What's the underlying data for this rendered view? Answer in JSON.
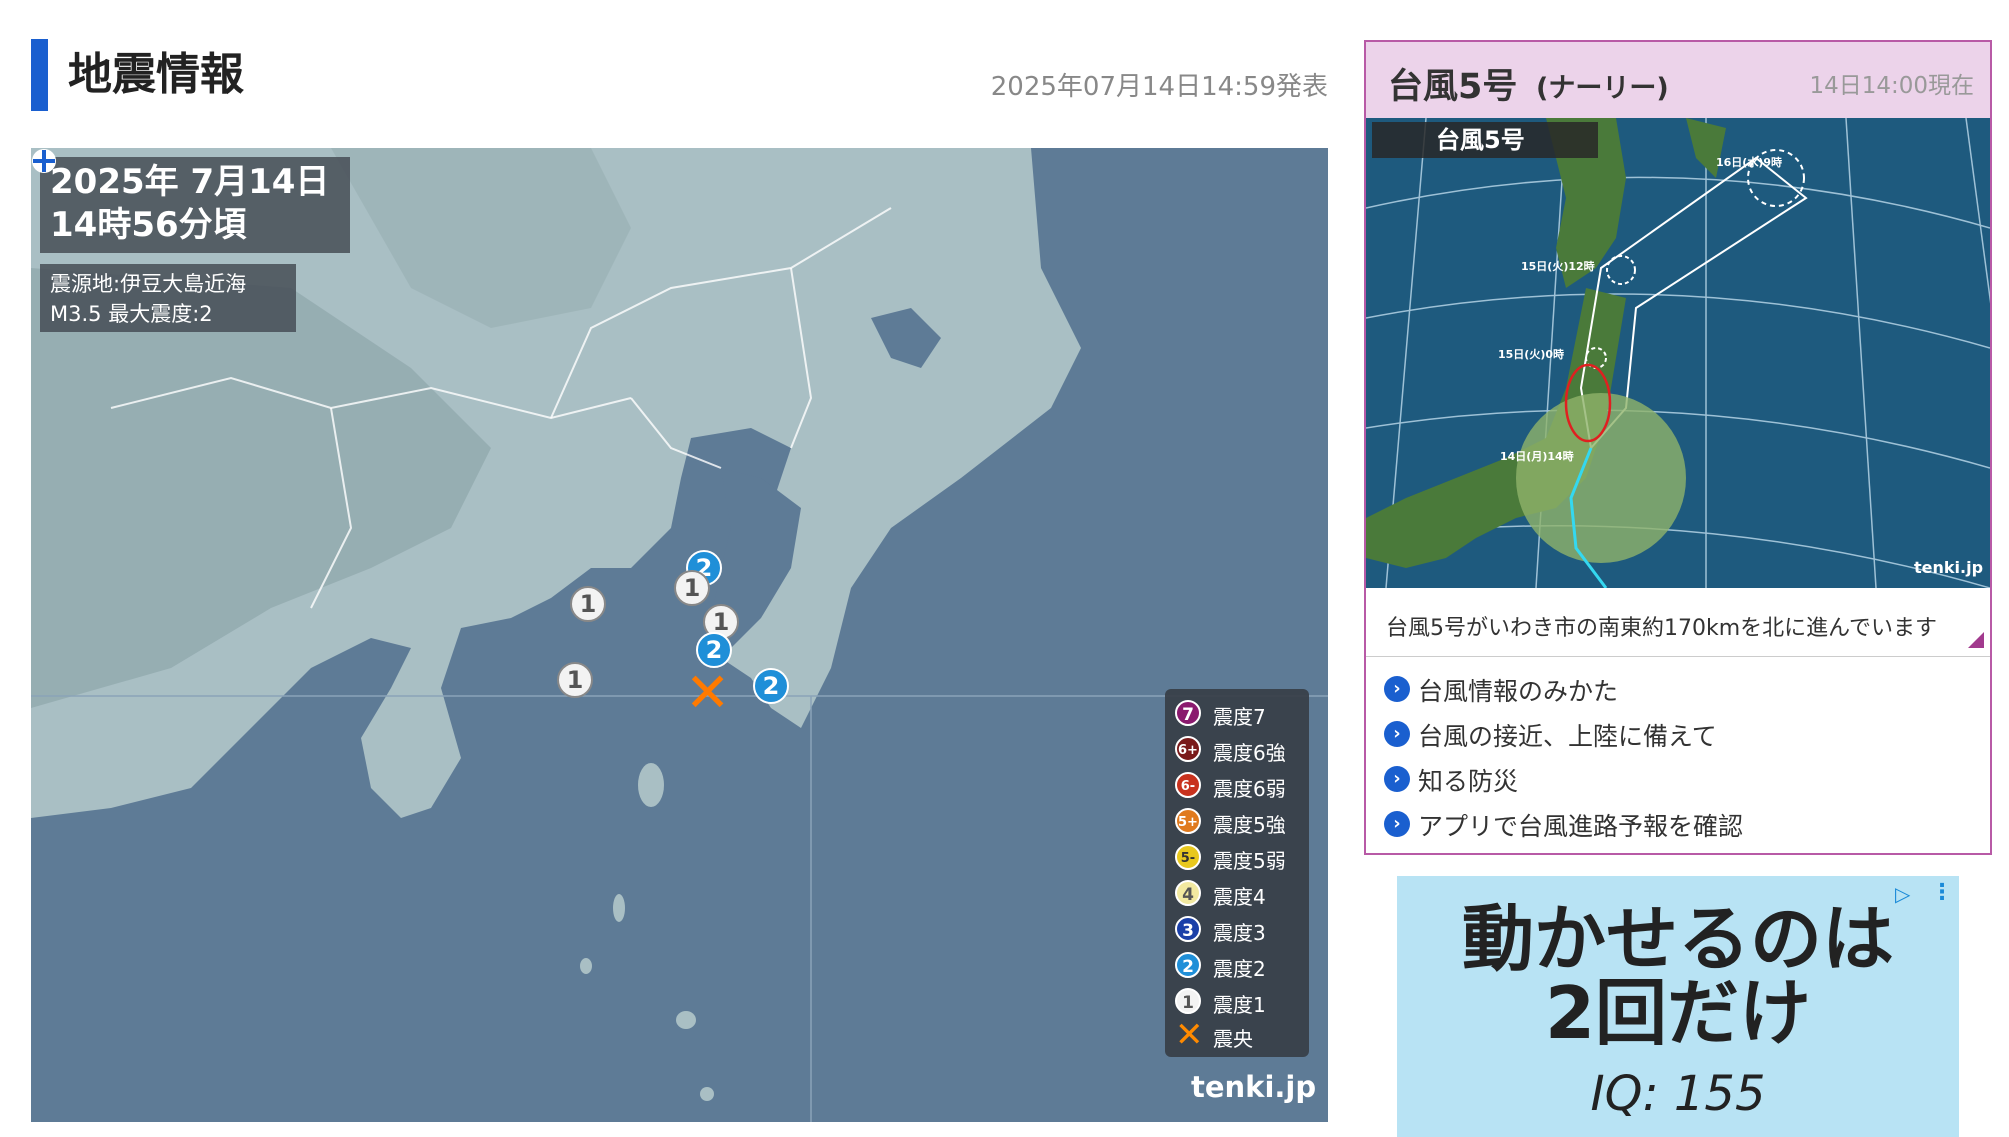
{
  "earthquake": {
    "title": "地震情報",
    "issued": "2025年07月14日14:59発表",
    "date": "2025年  7月14日",
    "time": "14時56分頃",
    "epicenter": "震源地:伊豆大島近海",
    "magnitude": "M3.5   最大震度:2",
    "markers": [
      {
        "value": "2",
        "level": 2
      },
      {
        "value": "1",
        "level": 1
      },
      {
        "value": "1",
        "level": 1
      },
      {
        "value": "1",
        "level": 1
      },
      {
        "value": "2",
        "level": 2
      },
      {
        "value": "1",
        "level": 1
      },
      {
        "value": "2",
        "level": 2
      }
    ],
    "legend": [
      {
        "badge": "7",
        "label": "震度7",
        "color": "#8a1a6e"
      },
      {
        "badge": "6+",
        "label": "震度6強",
        "color": "#7a1a1a"
      },
      {
        "badge": "6-",
        "label": "震度6弱",
        "color": "#c8321e"
      },
      {
        "badge": "5+",
        "label": "震度5強",
        "color": "#e07a1e"
      },
      {
        "badge": "5-",
        "label": "震度5弱",
        "color": "#e8c81e"
      },
      {
        "badge": "4",
        "label": "震度4",
        "color": "#f2e9a0"
      },
      {
        "badge": "3",
        "label": "震度3",
        "color": "#1a3fa8"
      },
      {
        "badge": "2",
        "label": "震度2",
        "color": "#1f8fd8"
      },
      {
        "badge": "1",
        "label": "震度1",
        "color": "#f3f3f3"
      }
    ],
    "legend_epicenter": "震央",
    "brand": "tenki.jp"
  },
  "typhoon": {
    "title": "台風5号",
    "nickname": "(ナーリー)",
    "as_of": "14日14:00現在",
    "map_label": "台風5号",
    "track_labels": [
      "16日(水)9時",
      "15日(火)12時",
      "15日(火)0時",
      "14日(月)14時"
    ],
    "map_brand": "tenki.jp",
    "description": "台風5号がいわき市の南東約170kmを北に進んでいます",
    "links": [
      "台風情報のみかた",
      "台風の接近、上陸に備えて",
      "知る防災",
      "アプリで台風進路予報を確認"
    ]
  },
  "ad": {
    "line1": "動かせるのは",
    "line2": "2回だけ",
    "line3": "IQ: 155",
    "choice_icon": "▷",
    "menu_icon": "⋮"
  }
}
